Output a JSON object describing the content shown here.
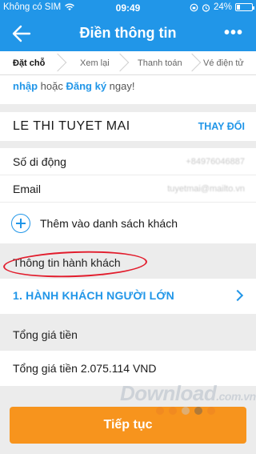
{
  "status_bar": {
    "carrier": "Không có SIM",
    "time": "09:49",
    "battery": "24%"
  },
  "nav": {
    "title": "Điền thông tin",
    "more": "•••"
  },
  "steps": [
    "Đặt chỗ",
    "Xem lại",
    "Thanh toán",
    "Vé điện tử"
  ],
  "banner": {
    "login_label": "nhập",
    "or_text": " hoặc ",
    "register_label": "Đăng ký",
    "suffix": " ngay!",
    "top_login": "Đăng"
  },
  "contact": {
    "name": "LE THI TUYET MAI",
    "change_label": "THAY ĐỔI",
    "phone_label": "Số di động",
    "phone_value": "+84976046887",
    "email_label": "Email",
    "email_value": "tuyetmai@mailto.vn",
    "add_to_list": "Thêm vào danh sách khách"
  },
  "passenger_section": {
    "title": "Thông tin hành khách",
    "adult": "1. HÀNH KHÁCH NGƯỜI LỚN"
  },
  "total_section": {
    "title": "Tổng giá tiền",
    "text": "Tổng giá tiền 2.075.114 VND"
  },
  "watermark": {
    "brand": "Download",
    "domain": ".com.vn"
  },
  "battery_level": 0.24,
  "colors": {
    "brand_blue": "#2196e8",
    "orange": "#f7941d",
    "highlight_red": "#e21c2c"
  },
  "continue_label": "Tiếp tục"
}
